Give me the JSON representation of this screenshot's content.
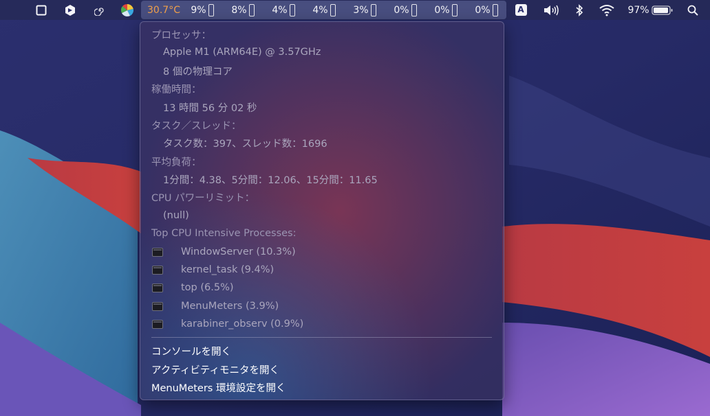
{
  "menubar": {
    "temperature": "30.7°C",
    "cpu_cores": [
      "9%",
      "8%",
      "4%",
      "4%",
      "3%",
      "0%",
      "0%",
      "0%"
    ],
    "input_source": "A",
    "battery_percent": "97%",
    "icons": [
      "window-icon",
      "app-icon",
      "spiral-icon",
      "color-wheel-icon",
      "speaker-icon",
      "bluetooth-icon",
      "wifi-icon",
      "battery-icon",
      "search-icon"
    ]
  },
  "menu": {
    "processor_header": "プロセッサ：",
    "processor_name": "Apple M1 (ARM64E) @ 3.57GHz",
    "processor_cores": "8 個の物理コア",
    "uptime_header": "稼働時間：",
    "uptime_value": "13 時間 56 分 02 秒",
    "tasks_header": "タスク／スレッド：",
    "tasks_value": "タスク数：397、スレッド数：1696",
    "load_header": "平均負荷：",
    "load_value": "1分間：4.38、5分間：12.06、15分間：11.65",
    "power_header": "CPU パワーリミット：",
    "power_value": "(null)",
    "top_header": "Top CPU Intensive Processes:",
    "processes": [
      "WindowServer (10.3%)",
      "kernel_task (9.4%)",
      "top (6.5%)",
      "MenuMeters (3.9%)",
      "karabiner_observ (0.9%)"
    ],
    "actions": [
      "コンソールを開く",
      "アクティビティモニタを開く",
      "MenuMeters 環境設定を開く"
    ]
  }
}
